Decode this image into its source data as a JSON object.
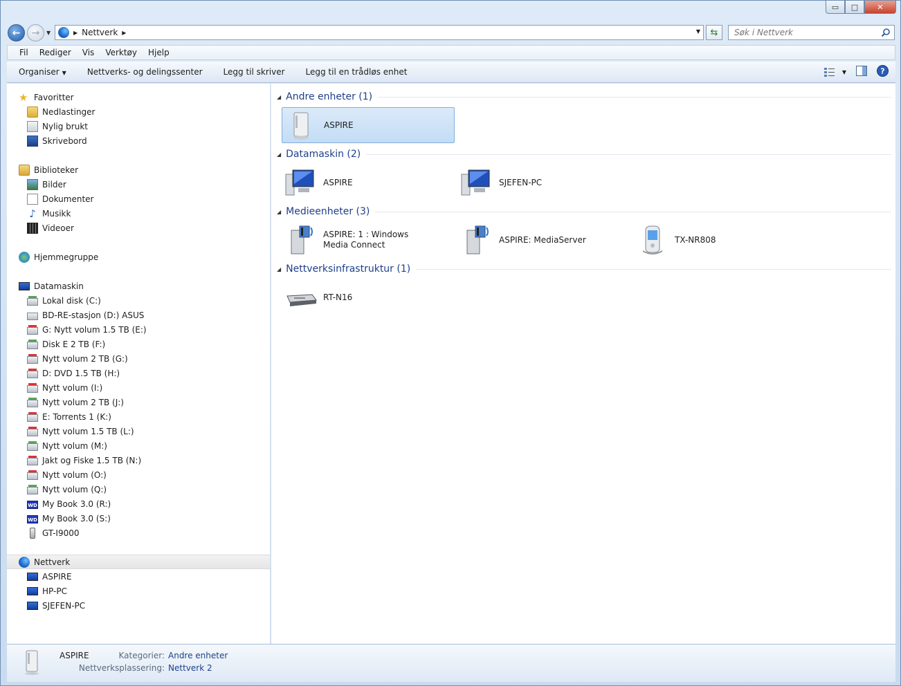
{
  "window": {
    "buttons": {
      "minimize": "▭",
      "maximize": "□",
      "close": "✕"
    }
  },
  "address": {
    "path": "Nettverk",
    "search_placeholder": "Søk i Nettverk"
  },
  "menu": [
    "Fil",
    "Rediger",
    "Vis",
    "Verktøy",
    "Hjelp"
  ],
  "toolbar": {
    "organize": "Organiser",
    "network_center": "Nettverks- og delingssenter",
    "add_printer": "Legg til skriver",
    "add_wireless": "Legg til en trådløs enhet"
  },
  "nav": {
    "favorites": {
      "label": "Favoritter",
      "items": [
        "Nedlastinger",
        "Nylig brukt",
        "Skrivebord"
      ]
    },
    "libraries": {
      "label": "Biblioteker",
      "items": [
        "Bilder",
        "Dokumenter",
        "Musikk",
        "Videoer"
      ]
    },
    "homegroup": "Hjemmegruppe",
    "computer": {
      "label": "Datamaskin",
      "items": [
        {
          "label": "Lokal disk (C:)",
          "icon": "drive-green-icon"
        },
        {
          "label": "BD-RE-stasjon (D:) ASUS",
          "icon": "optical-drive-icon"
        },
        {
          "label": "G: Nytt volum 1.5 TB (E:)",
          "icon": "drive-red-icon"
        },
        {
          "label": "Disk E 2 TB (F:)",
          "icon": "drive-green-icon"
        },
        {
          "label": "Nytt volum 2 TB (G:)",
          "icon": "drive-red-icon"
        },
        {
          "label": "D: DVD 1.5 TB (H:)",
          "icon": "drive-red-icon"
        },
        {
          "label": "Nytt volum (I:)",
          "icon": "drive-red-icon"
        },
        {
          "label": "Nytt volum 2 TB (J:)",
          "icon": "drive-green-icon"
        },
        {
          "label": "E: Torrents 1 (K:)",
          "icon": "drive-red-icon"
        },
        {
          "label": "Nytt volum 1.5 TB (L:)",
          "icon": "drive-red-icon"
        },
        {
          "label": "Nytt volum (M:)",
          "icon": "drive-green-icon"
        },
        {
          "label": "Jakt og Fiske 1.5 TB (N:)",
          "icon": "drive-red-icon"
        },
        {
          "label": "Nytt volum (O:)",
          "icon": "drive-red-icon"
        },
        {
          "label": "Nytt volum (Q:)",
          "icon": "drive-green-icon"
        },
        {
          "label": "My Book 3.0 (R:)",
          "icon": "wd-drive-icon"
        },
        {
          "label": "My Book 3.0 (S:)",
          "icon": "wd-drive-icon"
        },
        {
          "label": "GT-I9000",
          "icon": "phone-icon"
        }
      ]
    },
    "network": {
      "label": "Nettverk",
      "items": [
        "ASPIRE",
        "HP-PC",
        "SJEFEN-PC"
      ]
    }
  },
  "groups": [
    {
      "title": "Andre enheter (1)",
      "items": [
        "ASPIRE"
      ]
    },
    {
      "title": "Datamaskin (2)",
      "items": [
        "ASPIRE",
        "SJEFEN-PC"
      ]
    },
    {
      "title": "Medieenheter (3)",
      "items": [
        "ASPIRE: 1 : Windows Media Connect",
        "ASPIRE: MediaServer",
        "TX-NR808"
      ]
    },
    {
      "title": "Nettverksinfrastruktur (1)",
      "items": [
        "RT-N16"
      ]
    }
  ],
  "details": {
    "name": "ASPIRE",
    "category_label": "Kategorier:",
    "category_value": "Andre enheter",
    "location_label": "Nettverksplassering:",
    "location_value": "Nettverk  2"
  },
  "colors": {
    "accent": "#1e3f8a",
    "selection": "#c3dcf5"
  }
}
